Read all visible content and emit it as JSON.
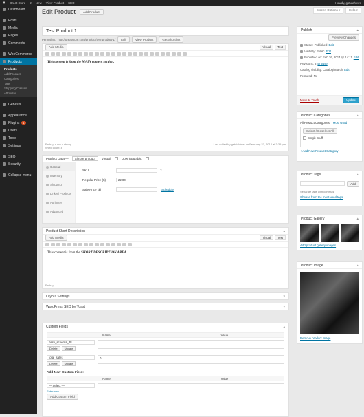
{
  "adminbar": {
    "site": "Great Store",
    "comments": "2",
    "updates": "0",
    "new": "New",
    "view": "View Product",
    "extra": "SEO",
    "howdy": "Howdy, gstuiahkwe"
  },
  "sidebar": {
    "items": [
      {
        "label": "Dashboard",
        "icon": "dashboard-icon"
      },
      {
        "label": "Posts",
        "icon": "pin-icon"
      },
      {
        "label": "Media",
        "icon": "media-icon"
      },
      {
        "label": "Pages",
        "icon": "page-icon"
      },
      {
        "label": "Comments",
        "icon": "comment-icon"
      },
      {
        "label": "WooCommerce",
        "icon": "woo-icon"
      },
      {
        "label": "Products",
        "icon": "product-icon"
      }
    ],
    "sub": [
      "Products",
      "Add Product",
      "Categories",
      "Tags",
      "Shipping Classes",
      "Attributes"
    ],
    "items2": [
      {
        "label": "Genesis",
        "icon": "genesis-icon"
      },
      {
        "label": "Appearance",
        "icon": "brush-icon"
      },
      {
        "label": "Plugins",
        "icon": "plugin-icon",
        "badge": "1"
      },
      {
        "label": "Users",
        "icon": "user-icon"
      },
      {
        "label": "Tools",
        "icon": "tools-icon"
      },
      {
        "label": "Settings",
        "icon": "settings-icon"
      },
      {
        "label": "SEO",
        "icon": "seo-icon"
      },
      {
        "label": "Security",
        "icon": "shield-icon"
      },
      {
        "label": "Collapse menu",
        "icon": "collapse-icon"
      }
    ]
  },
  "header": {
    "title": "Edit Product",
    "add_new": "Add Product",
    "screen_options": "Screen Options ▾",
    "help": "Help ▾"
  },
  "post": {
    "title": "Test Product 1",
    "permalink_label": "Permalink:",
    "permalink_url": "http://greatstore.com/product/test-product-1/",
    "edit": "Edit",
    "view": "View Product",
    "shortlink": "Get Shortlink"
  },
  "editor": {
    "add_media": "Add Media",
    "visual": "Visual",
    "text": "Text",
    "content": "This content is from the MAIN content section.",
    "path": "Path: p » em » strong",
    "wordcount": "Word count: 8",
    "last_edited": "Last edited by gstuiahkwe on February 27, 2014 at 3:35 pm"
  },
  "product_data": {
    "label": "Product Data —",
    "type": "Simple product",
    "virtual": "Virtual:",
    "downloadable": "Downloadable:",
    "tabs": [
      "General",
      "Inventory",
      "Shipping",
      "Linked Products",
      "Attributes",
      "Advanced"
    ],
    "sku_label": "SKU",
    "regular_label": "Regular Price ($)",
    "regular_value": "22.00",
    "sale_label": "Sale Price ($)",
    "schedule": "Schedule"
  },
  "short_desc": {
    "title": "Product Short Description",
    "add_media": "Add Media",
    "visual": "Visual",
    "text": "Text",
    "content_pre": "This content is from the ",
    "content_b": "SHORT DESCRIPTION AREA",
    "path": "Path: p"
  },
  "collapsed": [
    "Layout Settings",
    "WordPress SEO by Yoast"
  ],
  "custom_fields": {
    "title": "Custom Fields",
    "name_h": "Name",
    "value_h": "Value",
    "rows": [
      {
        "name": "bssb_schema_dtl",
        "value": ""
      },
      {
        "name": "total_sales",
        "value": "0"
      }
    ],
    "delete": "Delete",
    "update": "Update",
    "add_title": "Add New Custom Field:",
    "select": "— Select —",
    "enter_new": "Enter new",
    "add_btn": "Add Custom Field"
  },
  "publish": {
    "title": "Publish",
    "preview": "Preview Changes",
    "status": "Status: Published",
    "status_edit": "Edit",
    "visibility": "Visibility: Public",
    "vis_edit": "Edit",
    "published": "Published on: Feb 26, 2014 @ 14:11",
    "pub_edit": "Edit",
    "delete_trash": "Move to Trash",
    "update": "Update",
    "revisions": "Revisions: 3",
    "browse": "Browse",
    "catalog": "Catalog visibility: Catalog/search",
    "cat_edit": "Edit",
    "featured": "Featured: No"
  },
  "categories": {
    "title": "Product Categories",
    "all": "All Product Categories",
    "most": "Most Used",
    "select": "Select / Deselect All",
    "item": "Single Stuff",
    "add": "+ Add New Product Category"
  },
  "tags": {
    "title": "Product Tags",
    "add": "Add",
    "hint": "Separate tags with commas",
    "choose": "Choose from the most used tags"
  },
  "gallery": {
    "title": "Product Gallery",
    "add": "Add product gallery images"
  },
  "image": {
    "title": "Product Image",
    "remove": "Remove product image"
  }
}
